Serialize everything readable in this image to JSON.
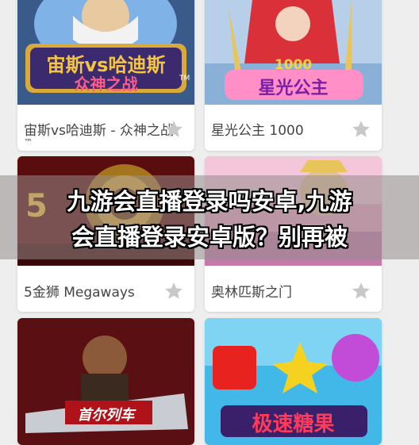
{
  "games": [
    {
      "title": "宙斯vs哈迪斯 - 众神之战",
      "title_extra": "™",
      "thumb_line1": "宙斯vs哈迪斯",
      "thumb_line2": "众神之战",
      "thumb_tm": "TM"
    },
    {
      "title": "星光公主 1000",
      "thumb_line1": "1000",
      "thumb_line2": "星光公主"
    },
    {
      "title": "5金狮 Megaways",
      "thumb_line1": "5"
    },
    {
      "title": "奥林匹斯之门"
    },
    {
      "title": "",
      "thumb_line1": "首尔列车"
    },
    {
      "title": "",
      "thumb_line1": "极速糖果"
    }
  ],
  "overlay": {
    "line1": "九游会直播登录吗安卓,九游",
    "line2": "会直播登录安卓版？别再被"
  },
  "colors": {
    "page_bg": "#eeeeee",
    "card_bg": "#ffffff",
    "star": "#c8c8c8",
    "caption": "#444444"
  },
  "icons": {
    "favorite": "star-icon"
  }
}
